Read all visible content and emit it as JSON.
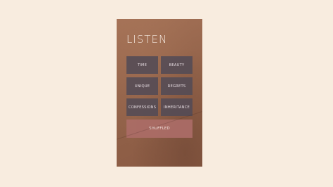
{
  "screen": {
    "title": "LISTEN"
  },
  "tiles": [
    {
      "label": "TIME"
    },
    {
      "label": "BEAUTY"
    },
    {
      "label": "UNIQUE"
    },
    {
      "label": "REGRETS"
    },
    {
      "label": "CONFESSIONS"
    },
    {
      "label": "INHERITANCE"
    }
  ],
  "shuffle_button": {
    "label": "SHUFFLED"
  },
  "colors": {
    "page_background": "#f8ecdf",
    "card_background": "#93634a",
    "tile": "#524a56",
    "shuffle_button": "#ab6c67",
    "title_text": "#f3e6dc"
  }
}
